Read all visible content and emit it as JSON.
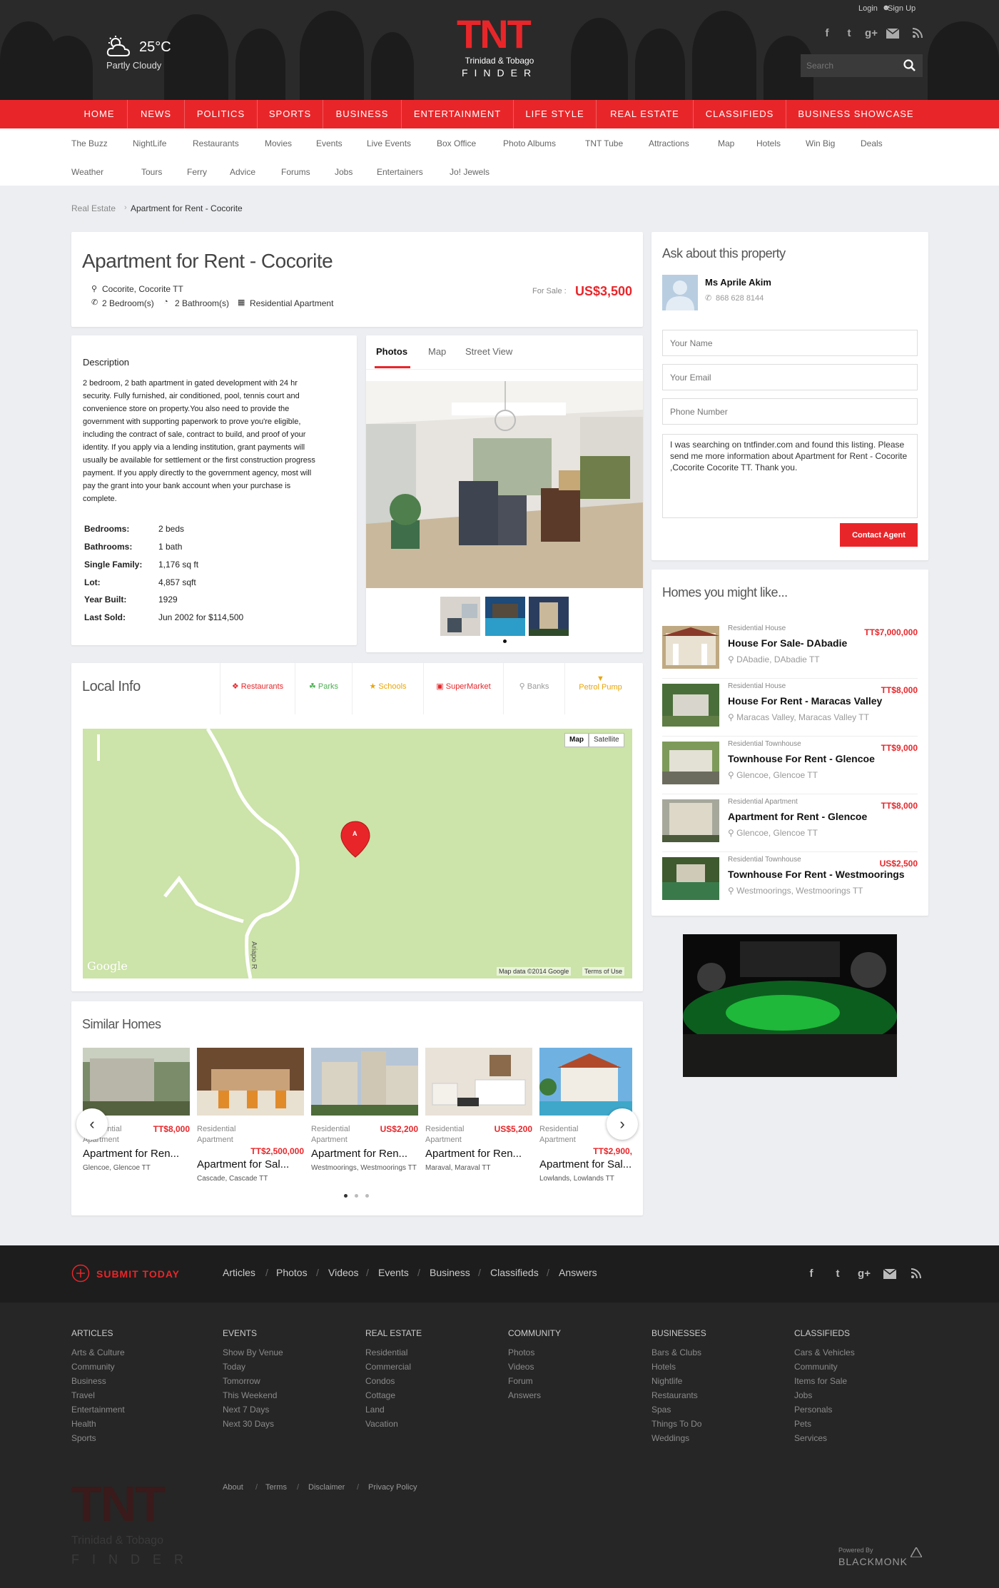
{
  "header": {
    "weather": {
      "temp": "25°C",
      "condition": "Partly Cloudy"
    },
    "logo": {
      "main": "TNT",
      "sub": "Trinidad & Tobago",
      "finder": "FINDER"
    },
    "login": "Login",
    "signup": "Sign Up",
    "search_placeholder": "Search",
    "social": [
      "f",
      "t",
      "g+",
      "mail",
      "rss"
    ]
  },
  "nav": [
    "HOME",
    "NEWS",
    "POLITICS",
    "SPORTS",
    "BUSINESS",
    "ENTERTAINMENT",
    "LIFE STYLE",
    "REAL ESTATE",
    "CLASSIFIEDS",
    "BUSINESS SHOWCASE"
  ],
  "subnav_row1": [
    "The Buzz",
    "NightLife",
    "Restaurants",
    "Movies",
    "Events",
    "Live Events",
    "Box Office",
    "Photo Albums",
    "TNT Tube",
    "Attractions",
    "Map",
    "Hotels",
    "Win Big",
    "Deals"
  ],
  "subnav_row2": [
    "Weather",
    "Tours",
    "Ferry",
    "Advice",
    "Forums",
    "Jobs",
    "Entertainers",
    "Jo! Jewels"
  ],
  "breadcrumb": {
    "parent": "Real Estate",
    "current": "Apartment for Rent - Cocorite"
  },
  "listing": {
    "title": "Apartment for Rent - Cocorite",
    "location": "Cocorite, Cocorite TT",
    "bedrooms": "2 Bedroom(s)",
    "bathrooms": "2 Bathroom(s)",
    "type": "Residential Apartment",
    "for_sale_label": "For Sale :",
    "price": "US$3,500"
  },
  "description": {
    "heading": "Description",
    "text": "2 bedroom, 2 bath apartment in gated development with 24 hr security. Fully furnished, air conditioned, pool, tennis court and convenience store on property.You also need to provide the government with supporting paperwork to prove you're eligible, including the contract of sale, contract to build, and proof of your identity. If you apply via a lending institution, grant payments will usually be available for settlement or the first construction progress payment. If you apply directly to the government agency, most will pay the grant into your bank account when your purchase is complete.",
    "facts": [
      {
        "label": "Bedrooms:",
        "value": "2 beds"
      },
      {
        "label": "Bathrooms:",
        "value": "1 bath"
      },
      {
        "label": "Single Family:",
        "value": "1,176 sq ft"
      },
      {
        "label": "Lot:",
        "value": "4,857 sqft"
      },
      {
        "label": "Year Built:",
        "value": "1929"
      },
      {
        "label": "Last Sold:",
        "value": "Jun 2002 for $114,500"
      }
    ]
  },
  "media_tabs": [
    "Photos",
    "Map",
    "Street View"
  ],
  "local_info": {
    "title": "Local Info",
    "categories": [
      "Restaurants",
      "Parks",
      "Schools",
      "SuperMarket",
      "Banks",
      "Petrol Pump"
    ],
    "map_buttons": [
      "Map",
      "Satellite"
    ],
    "map_marker": "A",
    "map_road": "Ariapo R",
    "map_credit": "Map data ©2014 Google",
    "map_terms": "Terms of Use",
    "map_logo": "Google"
  },
  "similar": {
    "title": "Similar Homes",
    "items": [
      {
        "type": "Residential Apartment",
        "price": "TT$8,000",
        "name": "Apartment for Ren...",
        "loc": "Glencoe, Glencoe TT"
      },
      {
        "type": "Residential Apartment",
        "price": "TT$2,500,000",
        "name": "Apartment for Sal...",
        "loc": "Cascade, Cascade TT"
      },
      {
        "type": "Residential Apartment",
        "price": "US$2,200",
        "name": "Apartment for Ren...",
        "loc": "Westmoorings, Westmoorings TT"
      },
      {
        "type": "Residential Apartment",
        "price": "US$5,200",
        "name": "Apartment for Ren...",
        "loc": "Maraval, Maraval TT"
      },
      {
        "type": "Residential Apartment",
        "price": "TT$2,900,",
        "name": "Apartment for Sal...",
        "loc": "Lowlands, Lowlands TT"
      }
    ]
  },
  "contact": {
    "title": "Ask about this property",
    "agent_name": "Ms Aprile Akim",
    "agent_phone": "868 628 8144",
    "name_placeholder": "Your Name",
    "email_placeholder": "Your Email",
    "phone_placeholder": "Phone Number",
    "message": "I was searching on tntfinder.com and found this listing. Please send me more information about Apartment for Rent - Cocorite ,Cocorite Cocorite TT. Thank you.",
    "button": "Contact Agent"
  },
  "homes_like": {
    "title": "Homes you might like...",
    "items": [
      {
        "type": "Residential House",
        "price": "TT$7,000,000",
        "name": "House For Sale- DAbadie",
        "loc": "DAbadie, DAbadie TT"
      },
      {
        "type": "Residential House",
        "price": "TT$8,000",
        "name": "House For Rent - Maracas Valley",
        "loc": "Maracas Valley, Maracas Valley TT"
      },
      {
        "type": "Residential Townhouse",
        "price": "TT$9,000",
        "name": "Townhouse For Rent - Glencoe",
        "loc": "Glencoe, Glencoe TT"
      },
      {
        "type": "Residential Apartment",
        "price": "TT$8,000",
        "name": "Apartment for Rent - Glencoe",
        "loc": "Glencoe, Glencoe TT"
      },
      {
        "type": "Residential Townhouse",
        "price": "US$2,500",
        "name": "Townhouse For Rent - Westmoorings",
        "loc": "Westmoorings, Westmoorings TT"
      }
    ]
  },
  "footer": {
    "submit": "SUBMIT TODAY",
    "top_links": [
      "Articles",
      "Photos",
      "Videos",
      "Events",
      "Business",
      "Classifieds",
      "Answers"
    ],
    "columns": [
      {
        "title": "ARTICLES",
        "links": [
          "Arts & Culture",
          "Community",
          "Business",
          "Travel",
          "Entertainment",
          "Health",
          "Sports"
        ]
      },
      {
        "title": "EVENTS",
        "links": [
          "Show By Venue",
          "Today",
          "Tomorrow",
          "This Weekend",
          "Next 7 Days",
          "Next 30 Days"
        ]
      },
      {
        "title": "REAL ESTATE",
        "links": [
          "Residential",
          "Commercial",
          "Condos",
          "Cottage",
          "Land",
          "Vacation"
        ]
      },
      {
        "title": "COMMUNITY",
        "links": [
          "Photos",
          "Videos",
          "Forum",
          "Answers"
        ]
      },
      {
        "title": "BUSINESSES",
        "links": [
          "Bars & Clubs",
          "Hotels",
          "Nightlife",
          "Restaurants",
          "Spas",
          "Things To Do",
          "Weddings"
        ]
      },
      {
        "title": "CLASSIFIEDS",
        "links": [
          "Cars & Vehicles",
          "Community",
          "Items for Sale",
          "Jobs",
          "Personals",
          "Pets",
          "Services"
        ]
      }
    ],
    "legal": [
      "About",
      "Terms",
      "Disclaimer",
      "Privacy Policy"
    ],
    "powered_by": "Powered By",
    "powered_name": "BLACKMONK"
  },
  "colors": {
    "accent": "#e8262a",
    "header_bg": "#2a2a2a",
    "footer_bg": "#262626"
  }
}
